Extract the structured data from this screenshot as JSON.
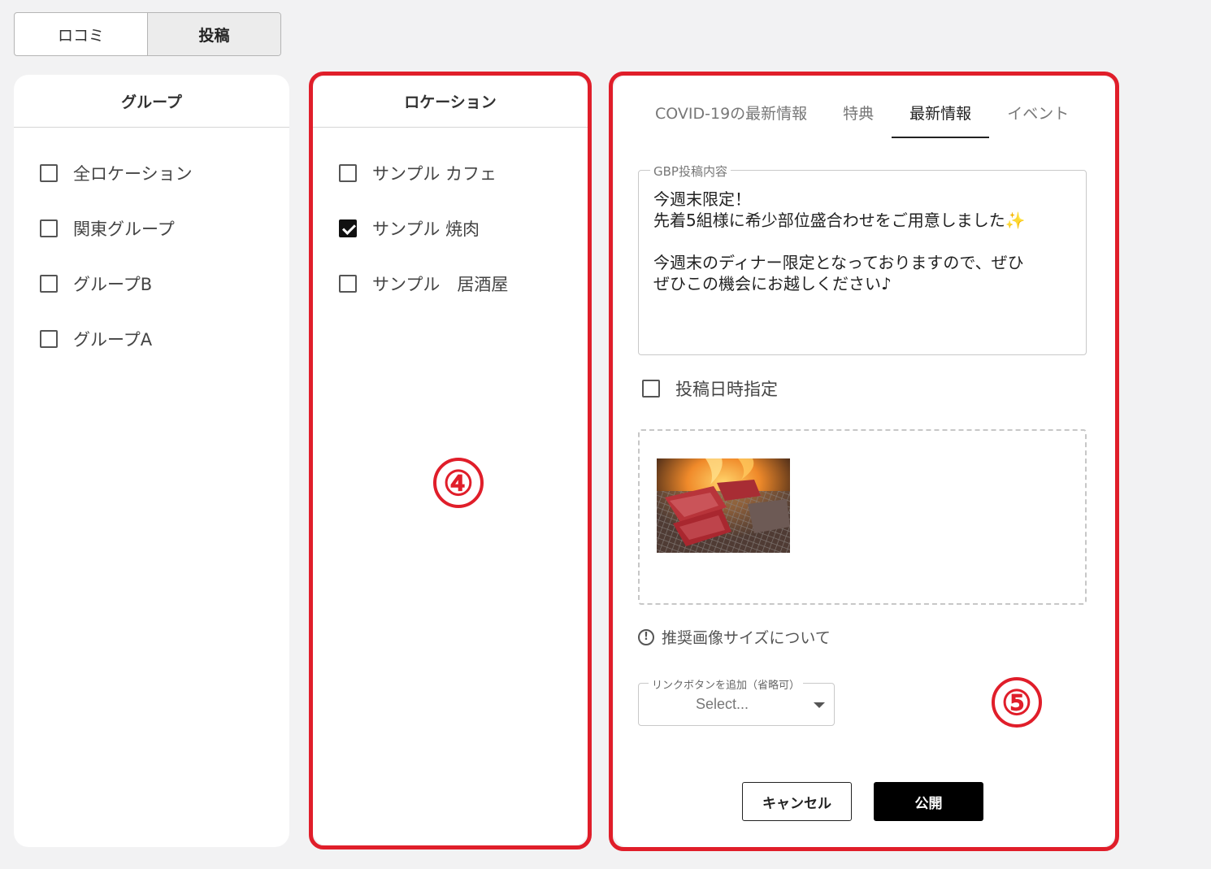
{
  "mode_tabs": [
    {
      "label": "ロコミ",
      "active": false
    },
    {
      "label": "投稿",
      "active": true
    }
  ],
  "group_panel": {
    "title": "グループ",
    "items": [
      {
        "label": "全ロケーション",
        "checked": false
      },
      {
        "label": "関東グループ",
        "checked": false
      },
      {
        "label": "グループB",
        "checked": false
      },
      {
        "label": "グループA",
        "checked": false
      }
    ]
  },
  "location_panel": {
    "title": "ロケーション",
    "items": [
      {
        "label": "サンプル カフェ",
        "checked": false
      },
      {
        "label": "サンプル 焼肉",
        "checked": true
      },
      {
        "label": "サンプル　居酒屋",
        "checked": false
      }
    ]
  },
  "annotations": {
    "marker_4": "④",
    "marker_5": "⑤",
    "accent_color": "#e01e2a"
  },
  "post_panel": {
    "tabs": [
      {
        "label": "COVID-19の最新情報",
        "active": false
      },
      {
        "label": "特典",
        "active": false
      },
      {
        "label": "最新情報",
        "active": true
      },
      {
        "label": "イベント",
        "active": false
      }
    ],
    "content_label": "GBP投稿内容",
    "content_lines": {
      "line1": "今週末限定！",
      "line2": "先着5組様に希少部位盛合わせをご用意しました",
      "line2_emoji": "✨",
      "line3": "今週末のディナー限定となっておりますので、ぜひ",
      "line4": "ぜひこの機会にお越しください♪"
    },
    "schedule_label": "投稿日時指定",
    "schedule_checked": false,
    "image_icon": "grilled-meat-photo",
    "recommend_label": "推奨画像サイズについて",
    "recommend_icon": "info-icon",
    "link_button": {
      "label": "リンクボタンを追加（省略可）",
      "placeholder": "Select..."
    },
    "cancel_label": "キャンセル",
    "publish_label": "公開"
  }
}
